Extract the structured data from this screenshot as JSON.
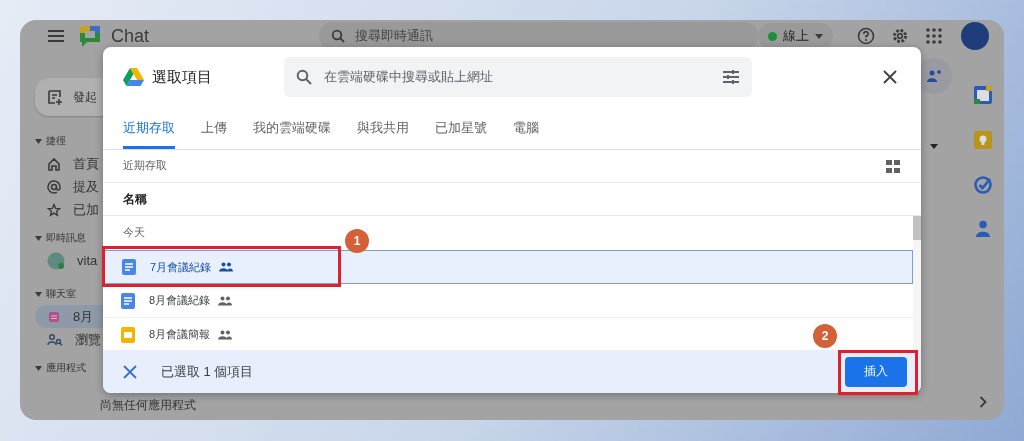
{
  "app": {
    "title": "Chat",
    "search": {
      "placeholder": "搜尋即時通訊"
    },
    "status": "線上",
    "new_chat": "發起",
    "sections": [
      {
        "title": "捷徑",
        "expanded": true,
        "items": [
          {
            "label": "首頁",
            "kind": "home",
            "selected": false
          },
          {
            "label": "提及",
            "kind": "mention",
            "selected": false
          },
          {
            "label": "已加",
            "kind": "star",
            "selected": false
          }
        ]
      },
      {
        "title": "即時訊息",
        "expanded": true,
        "items": [
          {
            "label": "vita",
            "kind": "person",
            "selected": false
          }
        ]
      },
      {
        "title": "聊天室",
        "expanded": true,
        "items": [
          {
            "label": "8月",
            "kind": "room",
            "selected": true
          },
          {
            "label": "瀏覽",
            "kind": "browse",
            "selected": false
          }
        ]
      },
      {
        "title": "應用程式",
        "expanded": true,
        "empty_text": "尚無任何應用程式"
      }
    ]
  },
  "dialog": {
    "title": "選取項目",
    "search": {
      "placeholder": "在雲端硬碟中搜尋或貼上網址"
    },
    "tabs": [
      {
        "label": "近期存取",
        "selected": true
      },
      {
        "label": "上傳",
        "selected": false
      },
      {
        "label": "我的雲端硬碟",
        "selected": false
      },
      {
        "label": "與我共用",
        "selected": false
      },
      {
        "label": "已加星號",
        "selected": false
      },
      {
        "label": "電腦",
        "selected": false
      }
    ],
    "breadcrumb": "近期存取",
    "column": "名稱",
    "group": "今天",
    "files": [
      {
        "name": "7月會議紀錄",
        "kind": "doc",
        "shared": true,
        "selected": true
      },
      {
        "name": "8月會議紀錄",
        "kind": "doc",
        "shared": true,
        "selected": false
      },
      {
        "name": "8月會議簡報",
        "kind": "slides",
        "shared": true,
        "selected": false
      }
    ],
    "footer": {
      "selection": "已選取 1 個項目",
      "insert_button": "插入"
    }
  },
  "annotations": [
    {
      "label": "1"
    },
    {
      "label": "2"
    }
  ]
}
